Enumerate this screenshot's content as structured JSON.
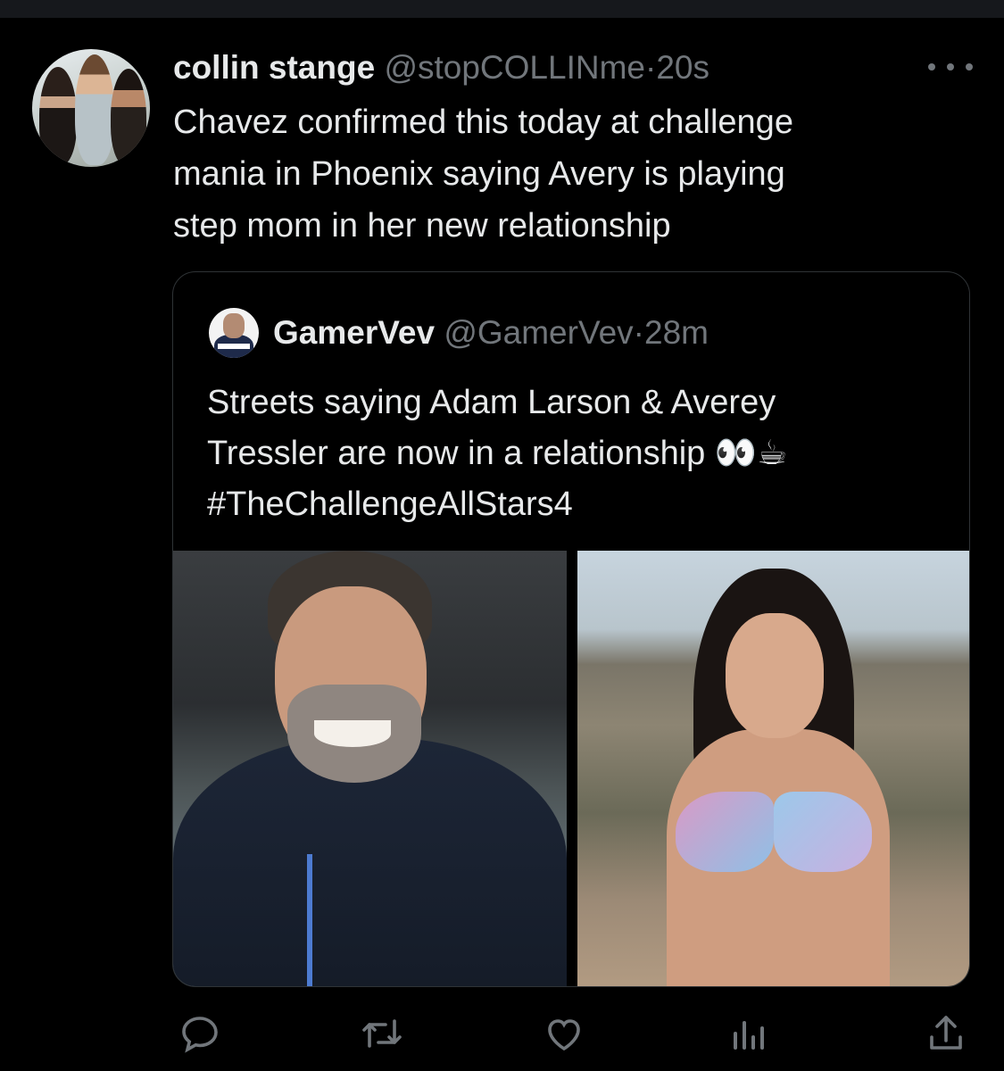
{
  "tweet": {
    "display_name": "collin stange",
    "handle": "@stopCOLLINme",
    "separator": "·",
    "time": "20s",
    "text": "Chavez confirmed this today at challenge\nmania in Phoenix saying Avery is playing\nstep mom in her new relationship"
  },
  "quote": {
    "display_name": "GamerVev",
    "handle": "@GamerVev",
    "separator": "·",
    "time": "28m",
    "text": "Streets saying  Adam Larson & Averey\nTressler are now in a relationship 👀☕\n#TheChallengeAllStars4"
  },
  "icons": {
    "more": "more-icon",
    "reply": "reply-icon",
    "retweet": "retweet-icon",
    "like": "like-icon",
    "views": "views-icon",
    "share": "share-icon"
  },
  "colors": {
    "background": "#000000",
    "text": "#e7e9ea",
    "secondary": "#71767b",
    "border": "#2f3336"
  }
}
